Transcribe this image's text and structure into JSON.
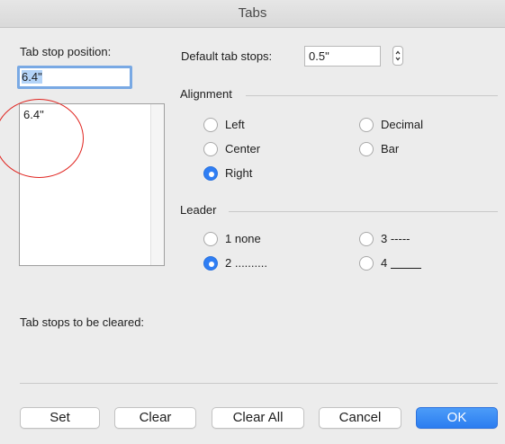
{
  "window": {
    "title": "Tabs"
  },
  "tab_stop_position": {
    "label": "Tab stop position:",
    "value": "6.4\""
  },
  "tab_stops_list": {
    "items": [
      "6.4\""
    ]
  },
  "default_tab_stops": {
    "label": "Default tab stops:",
    "value": "0.5\""
  },
  "alignment": {
    "title": "Alignment",
    "options": {
      "left": "Left",
      "decimal": "Decimal",
      "center": "Center",
      "bar": "Bar",
      "right": "Right"
    },
    "selected": "Right"
  },
  "leader": {
    "title": "Leader",
    "options": {
      "one": "1 none",
      "two": "2 ..........",
      "three": "3 -----",
      "four": "4"
    },
    "selected": "2 .........."
  },
  "cleared": {
    "label": "Tab stops to be cleared:"
  },
  "buttons": {
    "set": "Set",
    "clear": "Clear",
    "clear_all": "Clear All",
    "cancel": "Cancel",
    "ok": "OK"
  },
  "colors": {
    "accent": "#2f7ef4",
    "annotation": "#e0241f",
    "selection": "#b3d3f8"
  }
}
